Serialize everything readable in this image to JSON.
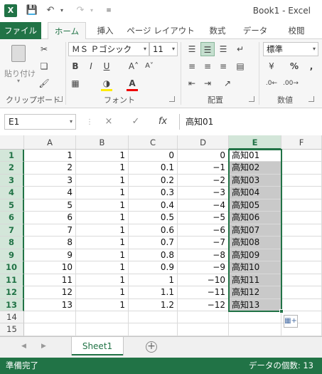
{
  "window": {
    "title": "Book1 - Excel",
    "app_icon": "excel-icon",
    "quick_access": [
      "save-icon",
      "undo-icon",
      "redo-icon",
      "customize-icon"
    ]
  },
  "ribbon": {
    "tabs": [
      {
        "label": "ファイル",
        "kind": "file"
      },
      {
        "label": "ホーム",
        "kind": "active"
      },
      {
        "label": "挿入",
        "kind": ""
      },
      {
        "label": "ページ レイアウト",
        "kind": ""
      },
      {
        "label": "数式",
        "kind": ""
      },
      {
        "label": "データ",
        "kind": ""
      },
      {
        "label": "校閲",
        "kind": ""
      }
    ],
    "clipboard": {
      "paste_label": "貼り付け",
      "group_label": "クリップボード"
    },
    "font": {
      "family": "ＭＳ Ｐゴシック",
      "size": "11",
      "group_label": "フォント"
    },
    "alignment": {
      "group_label": "配置"
    },
    "number": {
      "format": "標準",
      "group_label": "数値",
      "percent": "%",
      "comma": ","
    }
  },
  "formula_bar": {
    "name_box": "E1",
    "cancel_icon": "×",
    "enter_icon": "✓",
    "fx_label": "fx",
    "value": "高知01"
  },
  "grid": {
    "columns": [
      "A",
      "B",
      "C",
      "D",
      "E",
      "F"
    ],
    "selected_column": "E",
    "rows": [
      {
        "n": "1",
        "a": "1",
        "b": "1",
        "c": "0",
        "d": "0",
        "e": "高知01"
      },
      {
        "n": "2",
        "a": "2",
        "b": "1",
        "c": "0.1",
        "d": "−1",
        "e": "高知02"
      },
      {
        "n": "3",
        "a": "3",
        "b": "1",
        "c": "0.2",
        "d": "−2",
        "e": "高知03"
      },
      {
        "n": "4",
        "a": "4",
        "b": "1",
        "c": "0.3",
        "d": "−3",
        "e": "高知04"
      },
      {
        "n": "5",
        "a": "5",
        "b": "1",
        "c": "0.4",
        "d": "−4",
        "e": "高知05"
      },
      {
        "n": "6",
        "a": "6",
        "b": "1",
        "c": "0.5",
        "d": "−5",
        "e": "高知06"
      },
      {
        "n": "7",
        "a": "7",
        "b": "1",
        "c": "0.6",
        "d": "−6",
        "e": "高知07"
      },
      {
        "n": "8",
        "a": "8",
        "b": "1",
        "c": "0.7",
        "d": "−7",
        "e": "高知08"
      },
      {
        "n": "9",
        "a": "9",
        "b": "1",
        "c": "0.8",
        "d": "−8",
        "e": "高知09"
      },
      {
        "n": "10",
        "a": "10",
        "b": "1",
        "c": "0.9",
        "d": "−9",
        "e": "高知10"
      },
      {
        "n": "11",
        "a": "11",
        "b": "1",
        "c": "1",
        "d": "−10",
        "e": "高知11"
      },
      {
        "n": "12",
        "a": "12",
        "b": "1",
        "c": "1.1",
        "d": "−11",
        "e": "高知12"
      },
      {
        "n": "13",
        "a": "13",
        "b": "1",
        "c": "1.2",
        "d": "−12",
        "e": "高知13"
      },
      {
        "n": "14",
        "a": "",
        "b": "",
        "c": "",
        "d": "",
        "e": ""
      },
      {
        "n": "15",
        "a": "",
        "b": "",
        "c": "",
        "d": "",
        "e": ""
      }
    ]
  },
  "sheets": {
    "tabs": [
      "Sheet1"
    ],
    "active": "Sheet1"
  },
  "status": {
    "left": "準備完了",
    "right": "データの個数: 13"
  },
  "colors": {
    "accent": "#217346",
    "selection": "#c9c9c9"
  }
}
